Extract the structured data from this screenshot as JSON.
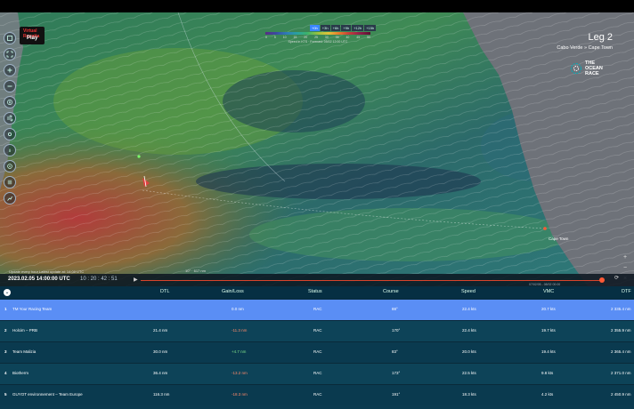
{
  "legend": {
    "tabs": [
      "+0h",
      "+3h",
      "+6h",
      "+9h",
      "+12h",
      "+15h"
    ],
    "active_tab": 0,
    "scale_numbers": [
      "0",
      "5",
      "10",
      "15",
      "20",
      "25",
      "30",
      "35",
      "40",
      "45",
      "50"
    ],
    "info": "Speed in KTS · Forecast: 05/02 12:00 UTC"
  },
  "race": {
    "leg_title": "Leg 2",
    "leg_route": "Cabo Verde » Cape Town",
    "brand_line1": "THE",
    "brand_line2": "OCEAN",
    "brand_line3": "RACE",
    "vr_logo_top": "Virtual Regatta",
    "vr_logo_bottom": "Play"
  },
  "map": {
    "destination_label": "Cape Town",
    "update_note": "Update every hour  Latest update at: 14:00 UTC",
    "scale": "10° · 617 nm",
    "brand_accent": "#0fa3b1",
    "track_color": "#ff5a36"
  },
  "timeline": {
    "date": "2023.02.05 14:00:00 UTC",
    "clock": "10 : 20 : 42 : 51",
    "track_date": "07/02/05 - 08/02 00:00"
  },
  "tools_left": [
    "layers-icon",
    "expand-icon",
    "zoom-in-icon",
    "zoom-out-icon",
    "compass-icon",
    "wind-icon",
    "settings-icon",
    "info-icon",
    "target-icon",
    "grid-icon",
    "chart-icon"
  ],
  "ranking": {
    "columns": {
      "dtl": "DTL",
      "gain": "Gain/Loss",
      "status": "Status",
      "course": "Course",
      "speed": "Speed",
      "vmc": "VMC",
      "dtf": "DTF"
    },
    "rows": [
      {
        "pos": "1",
        "name": "TM Your Racing Team",
        "dtl": "",
        "gain": "0.0 nm",
        "status": "RAC",
        "course": "88°",
        "speed": "22.4 kts",
        "vmc": "20.7 kts",
        "dtf": "2 335.4 nm",
        "gain_type": "neutral"
      },
      {
        "pos": "2",
        "name": "Holcim – PRB",
        "dtl": "21.4 nm",
        "gain": "-11.3 nm",
        "status": "RAC",
        "course": "170°",
        "speed": "22.4 kts",
        "vmc": "19.7 kts",
        "dtf": "2 355.9 nm",
        "gain_type": "neg"
      },
      {
        "pos": "3",
        "name": "Team Malizia",
        "dtl": "30.0 nm",
        "gain": "+4.7 nm",
        "status": "RAC",
        "course": "83°",
        "speed": "20.0 kts",
        "vmc": "19.4 kts",
        "dtf": "2 365.4 nm",
        "gain_type": "pos"
      },
      {
        "pos": "4",
        "name": "Biotherm",
        "dtl": "36.4 nm",
        "gain": "-13.2 nm",
        "status": "RAC",
        "course": "173°",
        "speed": "22.5 kts",
        "vmc": "9.8 kts",
        "dtf": "2 371.0 nm",
        "gain_type": "neg"
      },
      {
        "pos": "5",
        "name": "GUYOT environnement – Team Europe",
        "dtl": "116.3 nm",
        "gain": "-18.3 nm",
        "status": "RAC",
        "course": "191°",
        "speed": "18.3 kts",
        "vmc": "4.2 kts",
        "dtf": "2 450.9 nm",
        "gain_type": "neg"
      }
    ]
  }
}
